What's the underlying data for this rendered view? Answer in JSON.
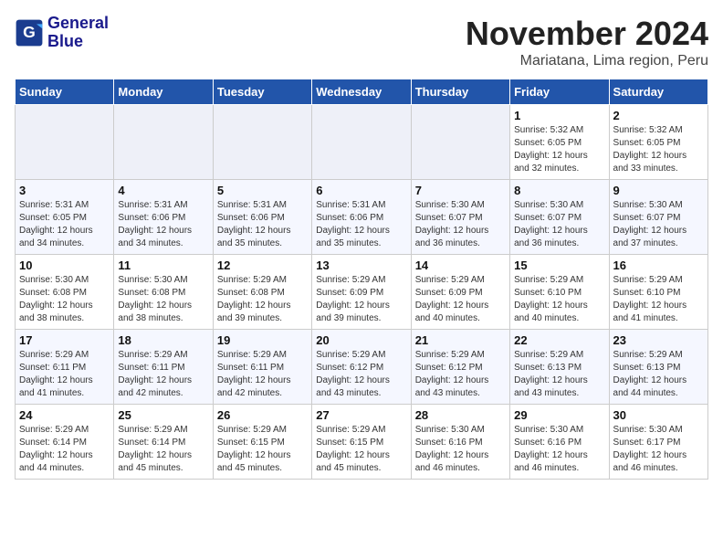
{
  "header": {
    "logo": {
      "line1": "General",
      "line2": "Blue"
    },
    "month_title": "November 2024",
    "location": "Mariatana, Lima region, Peru"
  },
  "days_of_week": [
    "Sunday",
    "Monday",
    "Tuesday",
    "Wednesday",
    "Thursday",
    "Friday",
    "Saturday"
  ],
  "weeks": [
    [
      {
        "day": "",
        "info": ""
      },
      {
        "day": "",
        "info": ""
      },
      {
        "day": "",
        "info": ""
      },
      {
        "day": "",
        "info": ""
      },
      {
        "day": "",
        "info": ""
      },
      {
        "day": "1",
        "info": "Sunrise: 5:32 AM\nSunset: 6:05 PM\nDaylight: 12 hours and 32 minutes."
      },
      {
        "day": "2",
        "info": "Sunrise: 5:32 AM\nSunset: 6:05 PM\nDaylight: 12 hours and 33 minutes."
      }
    ],
    [
      {
        "day": "3",
        "info": "Sunrise: 5:31 AM\nSunset: 6:05 PM\nDaylight: 12 hours and 34 minutes."
      },
      {
        "day": "4",
        "info": "Sunrise: 5:31 AM\nSunset: 6:06 PM\nDaylight: 12 hours and 34 minutes."
      },
      {
        "day": "5",
        "info": "Sunrise: 5:31 AM\nSunset: 6:06 PM\nDaylight: 12 hours and 35 minutes."
      },
      {
        "day": "6",
        "info": "Sunrise: 5:31 AM\nSunset: 6:06 PM\nDaylight: 12 hours and 35 minutes."
      },
      {
        "day": "7",
        "info": "Sunrise: 5:30 AM\nSunset: 6:07 PM\nDaylight: 12 hours and 36 minutes."
      },
      {
        "day": "8",
        "info": "Sunrise: 5:30 AM\nSunset: 6:07 PM\nDaylight: 12 hours and 36 minutes."
      },
      {
        "day": "9",
        "info": "Sunrise: 5:30 AM\nSunset: 6:07 PM\nDaylight: 12 hours and 37 minutes."
      }
    ],
    [
      {
        "day": "10",
        "info": "Sunrise: 5:30 AM\nSunset: 6:08 PM\nDaylight: 12 hours and 38 minutes."
      },
      {
        "day": "11",
        "info": "Sunrise: 5:30 AM\nSunset: 6:08 PM\nDaylight: 12 hours and 38 minutes."
      },
      {
        "day": "12",
        "info": "Sunrise: 5:29 AM\nSunset: 6:08 PM\nDaylight: 12 hours and 39 minutes."
      },
      {
        "day": "13",
        "info": "Sunrise: 5:29 AM\nSunset: 6:09 PM\nDaylight: 12 hours and 39 minutes."
      },
      {
        "day": "14",
        "info": "Sunrise: 5:29 AM\nSunset: 6:09 PM\nDaylight: 12 hours and 40 minutes."
      },
      {
        "day": "15",
        "info": "Sunrise: 5:29 AM\nSunset: 6:10 PM\nDaylight: 12 hours and 40 minutes."
      },
      {
        "day": "16",
        "info": "Sunrise: 5:29 AM\nSunset: 6:10 PM\nDaylight: 12 hours and 41 minutes."
      }
    ],
    [
      {
        "day": "17",
        "info": "Sunrise: 5:29 AM\nSunset: 6:11 PM\nDaylight: 12 hours and 41 minutes."
      },
      {
        "day": "18",
        "info": "Sunrise: 5:29 AM\nSunset: 6:11 PM\nDaylight: 12 hours and 42 minutes."
      },
      {
        "day": "19",
        "info": "Sunrise: 5:29 AM\nSunset: 6:11 PM\nDaylight: 12 hours and 42 minutes."
      },
      {
        "day": "20",
        "info": "Sunrise: 5:29 AM\nSunset: 6:12 PM\nDaylight: 12 hours and 43 minutes."
      },
      {
        "day": "21",
        "info": "Sunrise: 5:29 AM\nSunset: 6:12 PM\nDaylight: 12 hours and 43 minutes."
      },
      {
        "day": "22",
        "info": "Sunrise: 5:29 AM\nSunset: 6:13 PM\nDaylight: 12 hours and 43 minutes."
      },
      {
        "day": "23",
        "info": "Sunrise: 5:29 AM\nSunset: 6:13 PM\nDaylight: 12 hours and 44 minutes."
      }
    ],
    [
      {
        "day": "24",
        "info": "Sunrise: 5:29 AM\nSunset: 6:14 PM\nDaylight: 12 hours and 44 minutes."
      },
      {
        "day": "25",
        "info": "Sunrise: 5:29 AM\nSunset: 6:14 PM\nDaylight: 12 hours and 45 minutes."
      },
      {
        "day": "26",
        "info": "Sunrise: 5:29 AM\nSunset: 6:15 PM\nDaylight: 12 hours and 45 minutes."
      },
      {
        "day": "27",
        "info": "Sunrise: 5:29 AM\nSunset: 6:15 PM\nDaylight: 12 hours and 45 minutes."
      },
      {
        "day": "28",
        "info": "Sunrise: 5:30 AM\nSunset: 6:16 PM\nDaylight: 12 hours and 46 minutes."
      },
      {
        "day": "29",
        "info": "Sunrise: 5:30 AM\nSunset: 6:16 PM\nDaylight: 12 hours and 46 minutes."
      },
      {
        "day": "30",
        "info": "Sunrise: 5:30 AM\nSunset: 6:17 PM\nDaylight: 12 hours and 46 minutes."
      }
    ]
  ]
}
